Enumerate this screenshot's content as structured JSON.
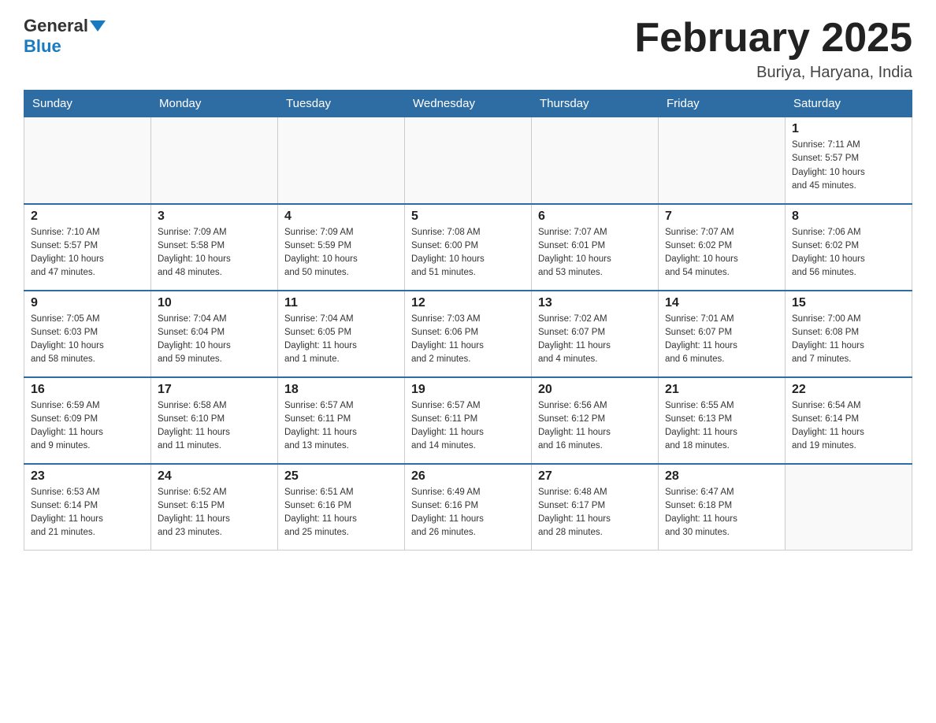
{
  "header": {
    "logo_main": "General",
    "logo_sub": "Blue",
    "month_title": "February 2025",
    "location": "Buriya, Haryana, India"
  },
  "weekdays": [
    "Sunday",
    "Monday",
    "Tuesday",
    "Wednesday",
    "Thursday",
    "Friday",
    "Saturday"
  ],
  "weeks": [
    [
      {
        "day": "",
        "info": ""
      },
      {
        "day": "",
        "info": ""
      },
      {
        "day": "",
        "info": ""
      },
      {
        "day": "",
        "info": ""
      },
      {
        "day": "",
        "info": ""
      },
      {
        "day": "",
        "info": ""
      },
      {
        "day": "1",
        "info": "Sunrise: 7:11 AM\nSunset: 5:57 PM\nDaylight: 10 hours\nand 45 minutes."
      }
    ],
    [
      {
        "day": "2",
        "info": "Sunrise: 7:10 AM\nSunset: 5:57 PM\nDaylight: 10 hours\nand 47 minutes."
      },
      {
        "day": "3",
        "info": "Sunrise: 7:09 AM\nSunset: 5:58 PM\nDaylight: 10 hours\nand 48 minutes."
      },
      {
        "day": "4",
        "info": "Sunrise: 7:09 AM\nSunset: 5:59 PM\nDaylight: 10 hours\nand 50 minutes."
      },
      {
        "day": "5",
        "info": "Sunrise: 7:08 AM\nSunset: 6:00 PM\nDaylight: 10 hours\nand 51 minutes."
      },
      {
        "day": "6",
        "info": "Sunrise: 7:07 AM\nSunset: 6:01 PM\nDaylight: 10 hours\nand 53 minutes."
      },
      {
        "day": "7",
        "info": "Sunrise: 7:07 AM\nSunset: 6:02 PM\nDaylight: 10 hours\nand 54 minutes."
      },
      {
        "day": "8",
        "info": "Sunrise: 7:06 AM\nSunset: 6:02 PM\nDaylight: 10 hours\nand 56 minutes."
      }
    ],
    [
      {
        "day": "9",
        "info": "Sunrise: 7:05 AM\nSunset: 6:03 PM\nDaylight: 10 hours\nand 58 minutes."
      },
      {
        "day": "10",
        "info": "Sunrise: 7:04 AM\nSunset: 6:04 PM\nDaylight: 10 hours\nand 59 minutes."
      },
      {
        "day": "11",
        "info": "Sunrise: 7:04 AM\nSunset: 6:05 PM\nDaylight: 11 hours\nand 1 minute."
      },
      {
        "day": "12",
        "info": "Sunrise: 7:03 AM\nSunset: 6:06 PM\nDaylight: 11 hours\nand 2 minutes."
      },
      {
        "day": "13",
        "info": "Sunrise: 7:02 AM\nSunset: 6:07 PM\nDaylight: 11 hours\nand 4 minutes."
      },
      {
        "day": "14",
        "info": "Sunrise: 7:01 AM\nSunset: 6:07 PM\nDaylight: 11 hours\nand 6 minutes."
      },
      {
        "day": "15",
        "info": "Sunrise: 7:00 AM\nSunset: 6:08 PM\nDaylight: 11 hours\nand 7 minutes."
      }
    ],
    [
      {
        "day": "16",
        "info": "Sunrise: 6:59 AM\nSunset: 6:09 PM\nDaylight: 11 hours\nand 9 minutes."
      },
      {
        "day": "17",
        "info": "Sunrise: 6:58 AM\nSunset: 6:10 PM\nDaylight: 11 hours\nand 11 minutes."
      },
      {
        "day": "18",
        "info": "Sunrise: 6:57 AM\nSunset: 6:11 PM\nDaylight: 11 hours\nand 13 minutes."
      },
      {
        "day": "19",
        "info": "Sunrise: 6:57 AM\nSunset: 6:11 PM\nDaylight: 11 hours\nand 14 minutes."
      },
      {
        "day": "20",
        "info": "Sunrise: 6:56 AM\nSunset: 6:12 PM\nDaylight: 11 hours\nand 16 minutes."
      },
      {
        "day": "21",
        "info": "Sunrise: 6:55 AM\nSunset: 6:13 PM\nDaylight: 11 hours\nand 18 minutes."
      },
      {
        "day": "22",
        "info": "Sunrise: 6:54 AM\nSunset: 6:14 PM\nDaylight: 11 hours\nand 19 minutes."
      }
    ],
    [
      {
        "day": "23",
        "info": "Sunrise: 6:53 AM\nSunset: 6:14 PM\nDaylight: 11 hours\nand 21 minutes."
      },
      {
        "day": "24",
        "info": "Sunrise: 6:52 AM\nSunset: 6:15 PM\nDaylight: 11 hours\nand 23 minutes."
      },
      {
        "day": "25",
        "info": "Sunrise: 6:51 AM\nSunset: 6:16 PM\nDaylight: 11 hours\nand 25 minutes."
      },
      {
        "day": "26",
        "info": "Sunrise: 6:49 AM\nSunset: 6:16 PM\nDaylight: 11 hours\nand 26 minutes."
      },
      {
        "day": "27",
        "info": "Sunrise: 6:48 AM\nSunset: 6:17 PM\nDaylight: 11 hours\nand 28 minutes."
      },
      {
        "day": "28",
        "info": "Sunrise: 6:47 AM\nSunset: 6:18 PM\nDaylight: 11 hours\nand 30 minutes."
      },
      {
        "day": "",
        "info": ""
      }
    ]
  ]
}
